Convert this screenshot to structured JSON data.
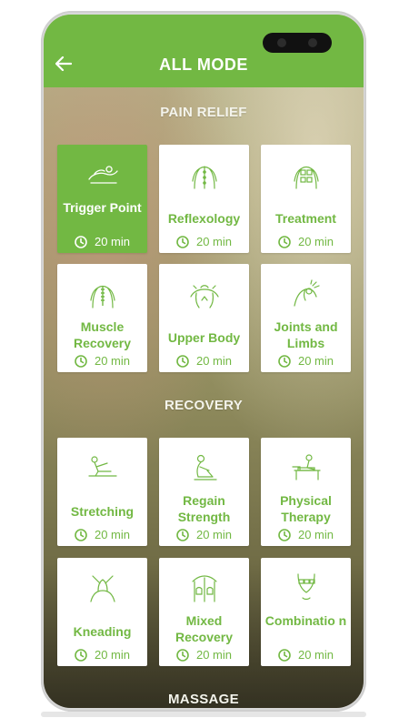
{
  "header": {
    "title": "ALL MODE",
    "back_icon": "arrow-left-icon"
  },
  "theme": {
    "accent": "#72b843"
  },
  "sections": [
    {
      "title": "PAIN RELIEF",
      "cards": [
        {
          "label": "Trigger Point",
          "duration": "20 min",
          "icon": "lying-person-icon",
          "selected": true
        },
        {
          "label": "Reflexology",
          "duration": "20 min",
          "icon": "body-back-icon",
          "selected": false
        },
        {
          "label": "Treatment",
          "duration": "20 min",
          "icon": "body-pads-icon",
          "selected": false
        },
        {
          "label": "Muscle Recovery",
          "duration": "20 min",
          "icon": "spine-icon",
          "selected": false
        },
        {
          "label": "Upper Body",
          "duration": "20 min",
          "icon": "shoulders-icon",
          "selected": false
        },
        {
          "label": "Joints and Limbs",
          "duration": "20 min",
          "icon": "shoulder-joint-icon",
          "selected": false
        }
      ]
    },
    {
      "title": "RECOVERY",
      "cards": [
        {
          "label": "Stretching",
          "duration": "20 min",
          "icon": "stretching-person-icon",
          "selected": false
        },
        {
          "label": "Regain Strength",
          "duration": "20 min",
          "icon": "sitting-person-icon",
          "selected": false
        },
        {
          "label": "Physical Therapy",
          "duration": "20 min",
          "icon": "therapy-table-icon",
          "selected": false
        },
        {
          "label": "Kneading",
          "duration": "20 min",
          "icon": "neck-massage-icon",
          "selected": false
        },
        {
          "label": "Mixed Recovery",
          "duration": "20 min",
          "icon": "back-massage-hands-icon",
          "selected": false
        },
        {
          "label": "Combinatio n",
          "duration": "20 min",
          "icon": "body-electrodes-icon",
          "selected": false
        }
      ]
    },
    {
      "title": "MASSAGE"
    }
  ]
}
